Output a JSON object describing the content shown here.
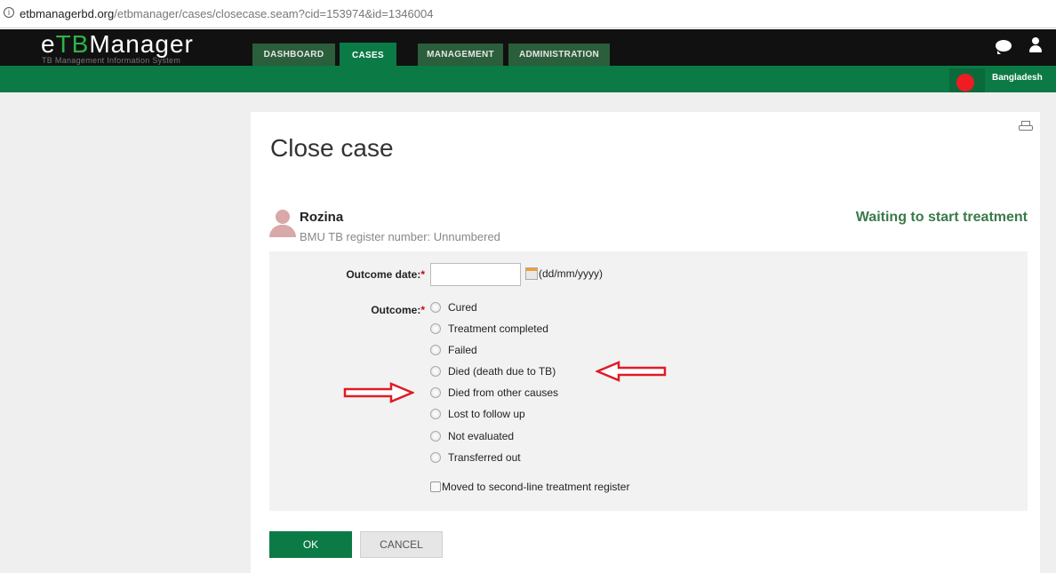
{
  "browser": {
    "info_icon": "info-icon",
    "url_domain": "etbmanagerbd.org",
    "url_path": "/etbmanager/cases/closecase.seam?cid=153974&id=1346004"
  },
  "app": {
    "logo_prefix": "e",
    "logo_accent": "TB",
    "logo_suffix": "Manager",
    "subtitle": "TB Management Information System",
    "colors": {
      "brand_green": "#0b7a45",
      "accent_green": "#2db34a",
      "topbar": "#111111",
      "required": "#d0021b"
    }
  },
  "nav": {
    "tabs": [
      {
        "label": "DASHBOARD",
        "active": false
      },
      {
        "label": "CASES",
        "active": true
      },
      {
        "label": "MANAGEMENT",
        "active": false
      },
      {
        "label": "ADMINISTRATION",
        "active": false
      }
    ],
    "icons": [
      "chat-icon",
      "user-icon"
    ],
    "country": "Bangladesh"
  },
  "page": {
    "title": "Close case",
    "print_icon": "print-icon"
  },
  "patient": {
    "name": "Rozina",
    "register": "BMU TB register number: Unnumbered",
    "status": "Waiting to start treatment"
  },
  "form": {
    "outcome_date_label": "Outcome date:",
    "required_mark": "*",
    "outcome_date_value": "",
    "date_hint": "(dd/mm/yyyy)",
    "outcome_label": "Outcome:",
    "outcomes": [
      "Cured",
      "Treatment completed",
      "Failed",
      "Died (death due to TB)",
      "Died from other causes",
      "Lost to follow up",
      "Not evaluated",
      "Transferred out"
    ],
    "moved_label": "Moved to second-line treatment register",
    "moved_checked": false
  },
  "actions": {
    "ok": "OK",
    "cancel": "CANCEL"
  }
}
